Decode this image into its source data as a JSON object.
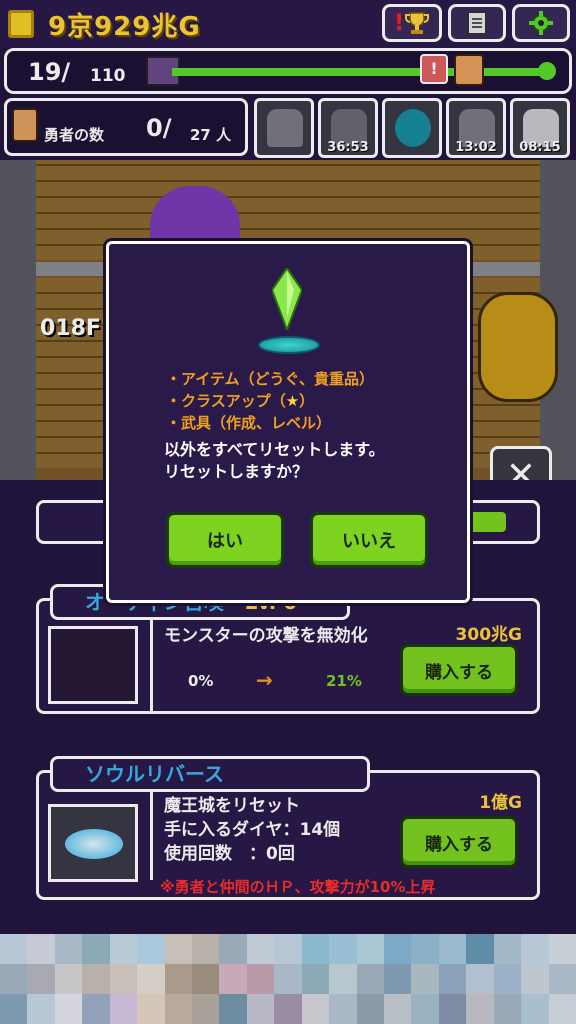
{
  "header": {
    "gold": "9京929兆G",
    "alert_mark": "!",
    "icons": [
      "trophy-icon",
      "document-icon",
      "gear-icon"
    ]
  },
  "floor_progress": {
    "current": "19/",
    "max": "110",
    "alert_mark": "!"
  },
  "heroes": {
    "label": "勇者の数",
    "count": "0/",
    "max": "27 人"
  },
  "monster_slots": [
    {
      "timer": ""
    },
    {
      "timer": "36:53"
    },
    {
      "timer": ""
    },
    {
      "timer": "13:02"
    },
    {
      "timer": "08:15"
    }
  ],
  "scene": {
    "floor_label": "018F"
  },
  "dialog": {
    "options": [
      "・アイテム（どうぐ、貴重品）",
      "・クラスアップ（",
      "）",
      "・武具（作成、レベル）"
    ],
    "message_line1": "以外をすべてリセットします。",
    "message_line2": "リセットしますか？",
    "yes_label": "はい",
    "no_label": "いいえ"
  },
  "items": [
    {
      "title": "オーディン召喚",
      "level": "Lv. 0",
      "description": "モンスターの攻撃を無効化",
      "from_value": "0%",
      "arrow": "→",
      "to_value": "21%",
      "price": "300兆G",
      "buy_label": "購入する"
    },
    {
      "title": "ソウルリバース",
      "description_lines": [
        "魔王城をリセット",
        "手に入るダイヤ：14個",
        "使用回数　：0回"
      ],
      "warning": "※勇者と仲間のＨＰ、攻撃力が10%上昇",
      "price": "1億G",
      "buy_label": "購入する"
    }
  ],
  "colors": {
    "accent_green": "#7ed321",
    "gold": "#ffd43b",
    "title_blue": "#3ab8f0",
    "warning_red": "#ff3030",
    "orange": "#f0a020",
    "panel_bg": "#2a1a4a"
  }
}
